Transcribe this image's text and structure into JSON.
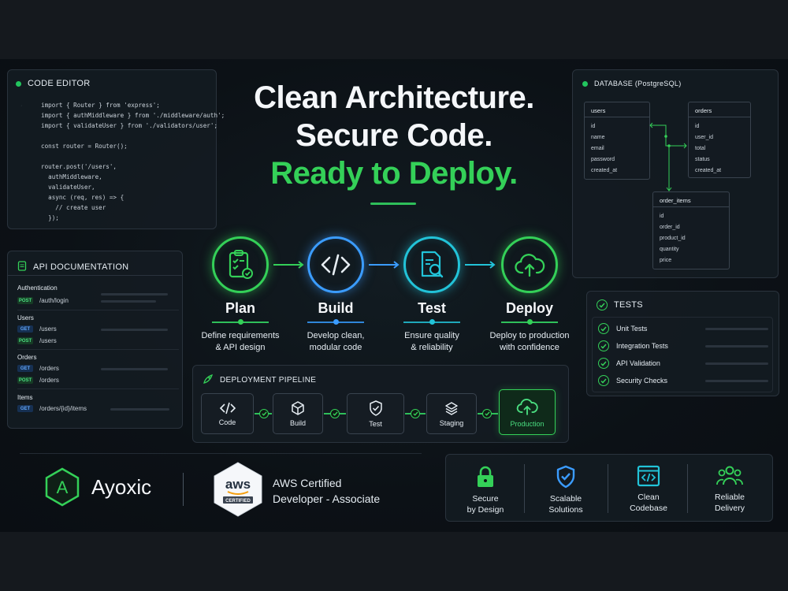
{
  "code_editor": {
    "title": "CODE EDITOR",
    "lines": [
      "import { Router } from 'express';",
      "import { authMiddleware } from './middleware/auth';",
      "import { validateUser } from './validators/user';",
      "",
      "const router = Router();",
      "",
      "router.post('/users',",
      "  authMiddleware,",
      "  validateUser,",
      "  async (req, res) => {",
      "    // create user",
      "  });"
    ]
  },
  "api_docs": {
    "title": "API DOCUMENTATION",
    "groups": [
      {
        "name": "Authentication",
        "endpoints": [
          {
            "method": "POST",
            "path": "/auth/login"
          }
        ]
      },
      {
        "name": "Users",
        "endpoints": [
          {
            "method": "GET",
            "path": "/users"
          },
          {
            "method": "POST",
            "path": "/users"
          }
        ]
      },
      {
        "name": "Orders",
        "endpoints": [
          {
            "method": "GET",
            "path": "/orders"
          },
          {
            "method": "POST",
            "path": "/orders"
          }
        ]
      },
      {
        "name": "Items",
        "endpoints": [
          {
            "method": "GET",
            "path": "/orders/{id}/items"
          }
        ]
      }
    ]
  },
  "headline": {
    "line1": "Clean Architecture.",
    "line2": "Secure Code.",
    "line3": "Ready to Deploy."
  },
  "steps": [
    {
      "name": "Plan",
      "desc1": "Define requirements",
      "desc2": "& API design",
      "icon": "clipboard-check-icon",
      "color": "#34d058"
    },
    {
      "name": "Build",
      "desc1": "Develop clean,",
      "desc2": "modular code",
      "icon": "code-icon",
      "color": "#3b9cff"
    },
    {
      "name": "Test",
      "desc1": "Ensure quality",
      "desc2": "& reliability",
      "icon": "document-search-icon",
      "color": "#22c3d8"
    },
    {
      "name": "Deploy",
      "desc1": "Deploy to production",
      "desc2": "with confidence",
      "icon": "cloud-upload-icon",
      "color": "#34d058"
    }
  ],
  "database": {
    "title": "DATABASE (PostgreSQL)",
    "tables": [
      {
        "name": "users",
        "fields": [
          "id",
          "name",
          "email",
          "password",
          "created_at"
        ]
      },
      {
        "name": "orders",
        "fields": [
          "id",
          "user_id",
          "total",
          "status",
          "created_at"
        ]
      },
      {
        "name": "order_items",
        "fields": [
          "id",
          "order_id",
          "product_id",
          "quantity",
          "price"
        ]
      }
    ]
  },
  "tests": {
    "title": "TESTS",
    "items": [
      "Unit Tests",
      "Integration Tests",
      "API Validation",
      "Security Checks"
    ]
  },
  "pipeline": {
    "title": "DEPLOYMENT PIPELINE",
    "stages": [
      {
        "label": "Code",
        "icon": "code-icon"
      },
      {
        "label": "Build",
        "icon": "box-icon"
      },
      {
        "label": "Test",
        "icon": "shield-check-icon"
      },
      {
        "label": "Staging",
        "icon": "layers-icon"
      },
      {
        "label": "Production",
        "icon": "cloud-upload-icon"
      }
    ]
  },
  "brand": {
    "name": "Ayoxic",
    "logo_letter": "A",
    "badge_top": "aws",
    "badge_bottom": "CERTIFIED",
    "cert_line1": "AWS Certified",
    "cert_line2": "Developer - Associate"
  },
  "values": [
    {
      "line1": "Secure",
      "line2": "by Design",
      "icon": "lock-icon",
      "color": "#34d058"
    },
    {
      "line1": "Scalable",
      "line2": "Solutions",
      "icon": "shield-check-icon",
      "color": "#3b9cff"
    },
    {
      "line1": "Clean",
      "line2": "Codebase",
      "icon": "code-window-icon",
      "color": "#22c3d8"
    },
    {
      "line1": "Reliable",
      "line2": "Delivery",
      "icon": "team-icon",
      "color": "#34d058"
    }
  ],
  "colors": {
    "accent_green": "#34d058",
    "accent_blue": "#3b9cff",
    "accent_teal": "#22c3d8",
    "background": "#0c1116"
  }
}
